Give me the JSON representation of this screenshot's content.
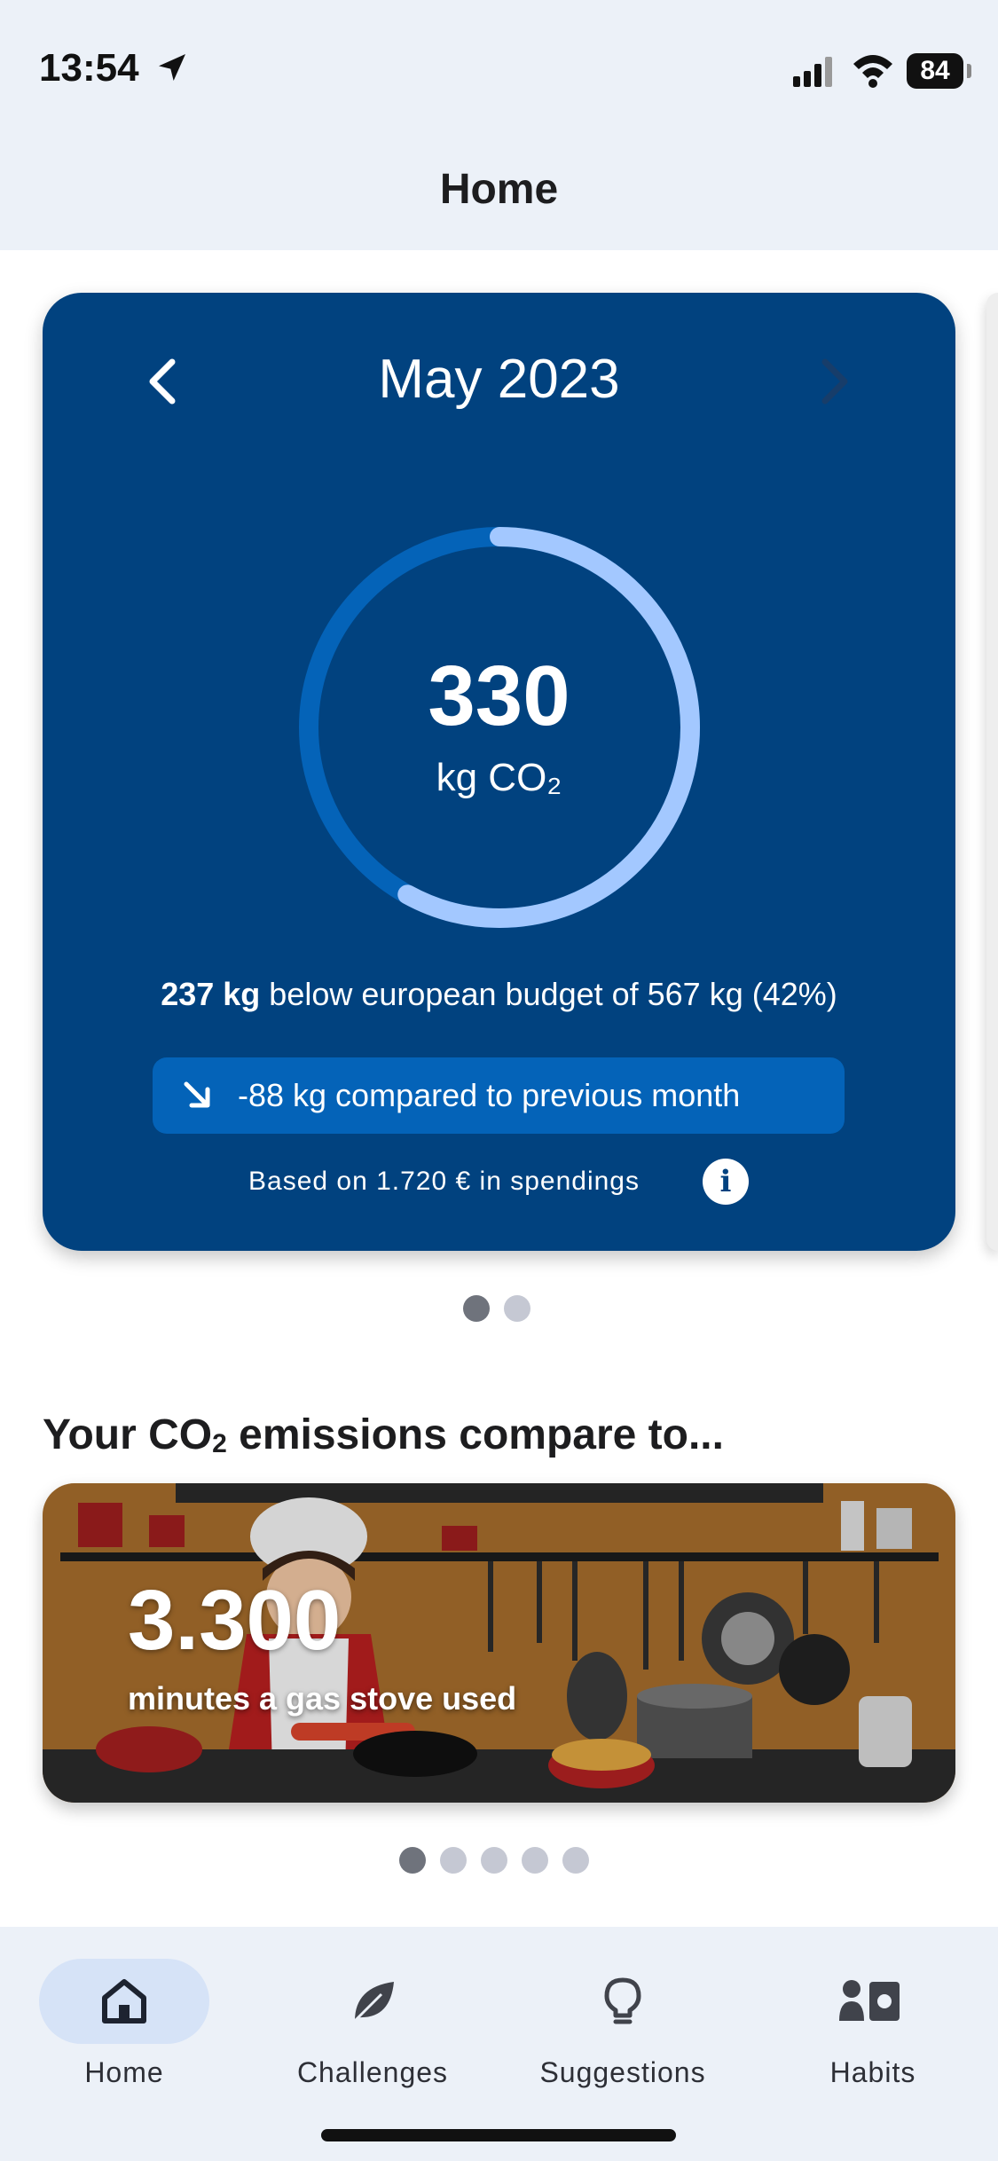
{
  "status_bar": {
    "time": "13:54",
    "battery": "84"
  },
  "header": {
    "title": "Home"
  },
  "card": {
    "month": "May 2023",
    "value": "330",
    "unit": "kg CO₂",
    "progress_fraction": 0.58,
    "budget_bold": "237 kg",
    "budget_rest": " below european budget of 567 kg (42%)",
    "comparison": "-88 kg compared to previous month",
    "based_on": "Based on 1.720 € in spendings",
    "info_icon": "i"
  },
  "pager_dots": {
    "count": 2,
    "active": 0
  },
  "section": {
    "title_prefix": "Your CO",
    "title_sub": "2",
    "title_suffix": " emissions compare to..."
  },
  "comparison_card": {
    "value": "3.300",
    "label": "minutes a gas stove used"
  },
  "comparison_dots": {
    "count": 5,
    "active": 0
  },
  "tabs": [
    {
      "label": "Home",
      "icon": "home-icon",
      "active": true
    },
    {
      "label": "Challenges",
      "icon": "leaf-icon",
      "active": false
    },
    {
      "label": "Suggestions",
      "icon": "lightbulb-icon",
      "active": false
    },
    {
      "label": "Habits",
      "icon": "habits-icon",
      "active": false
    }
  ],
  "colors": {
    "card_bg": "#01427f",
    "ring_track": "#0463b8",
    "ring_progress": "#a3c8ff",
    "pill": "#0463b8",
    "active_tab": "#d6e3f7"
  }
}
